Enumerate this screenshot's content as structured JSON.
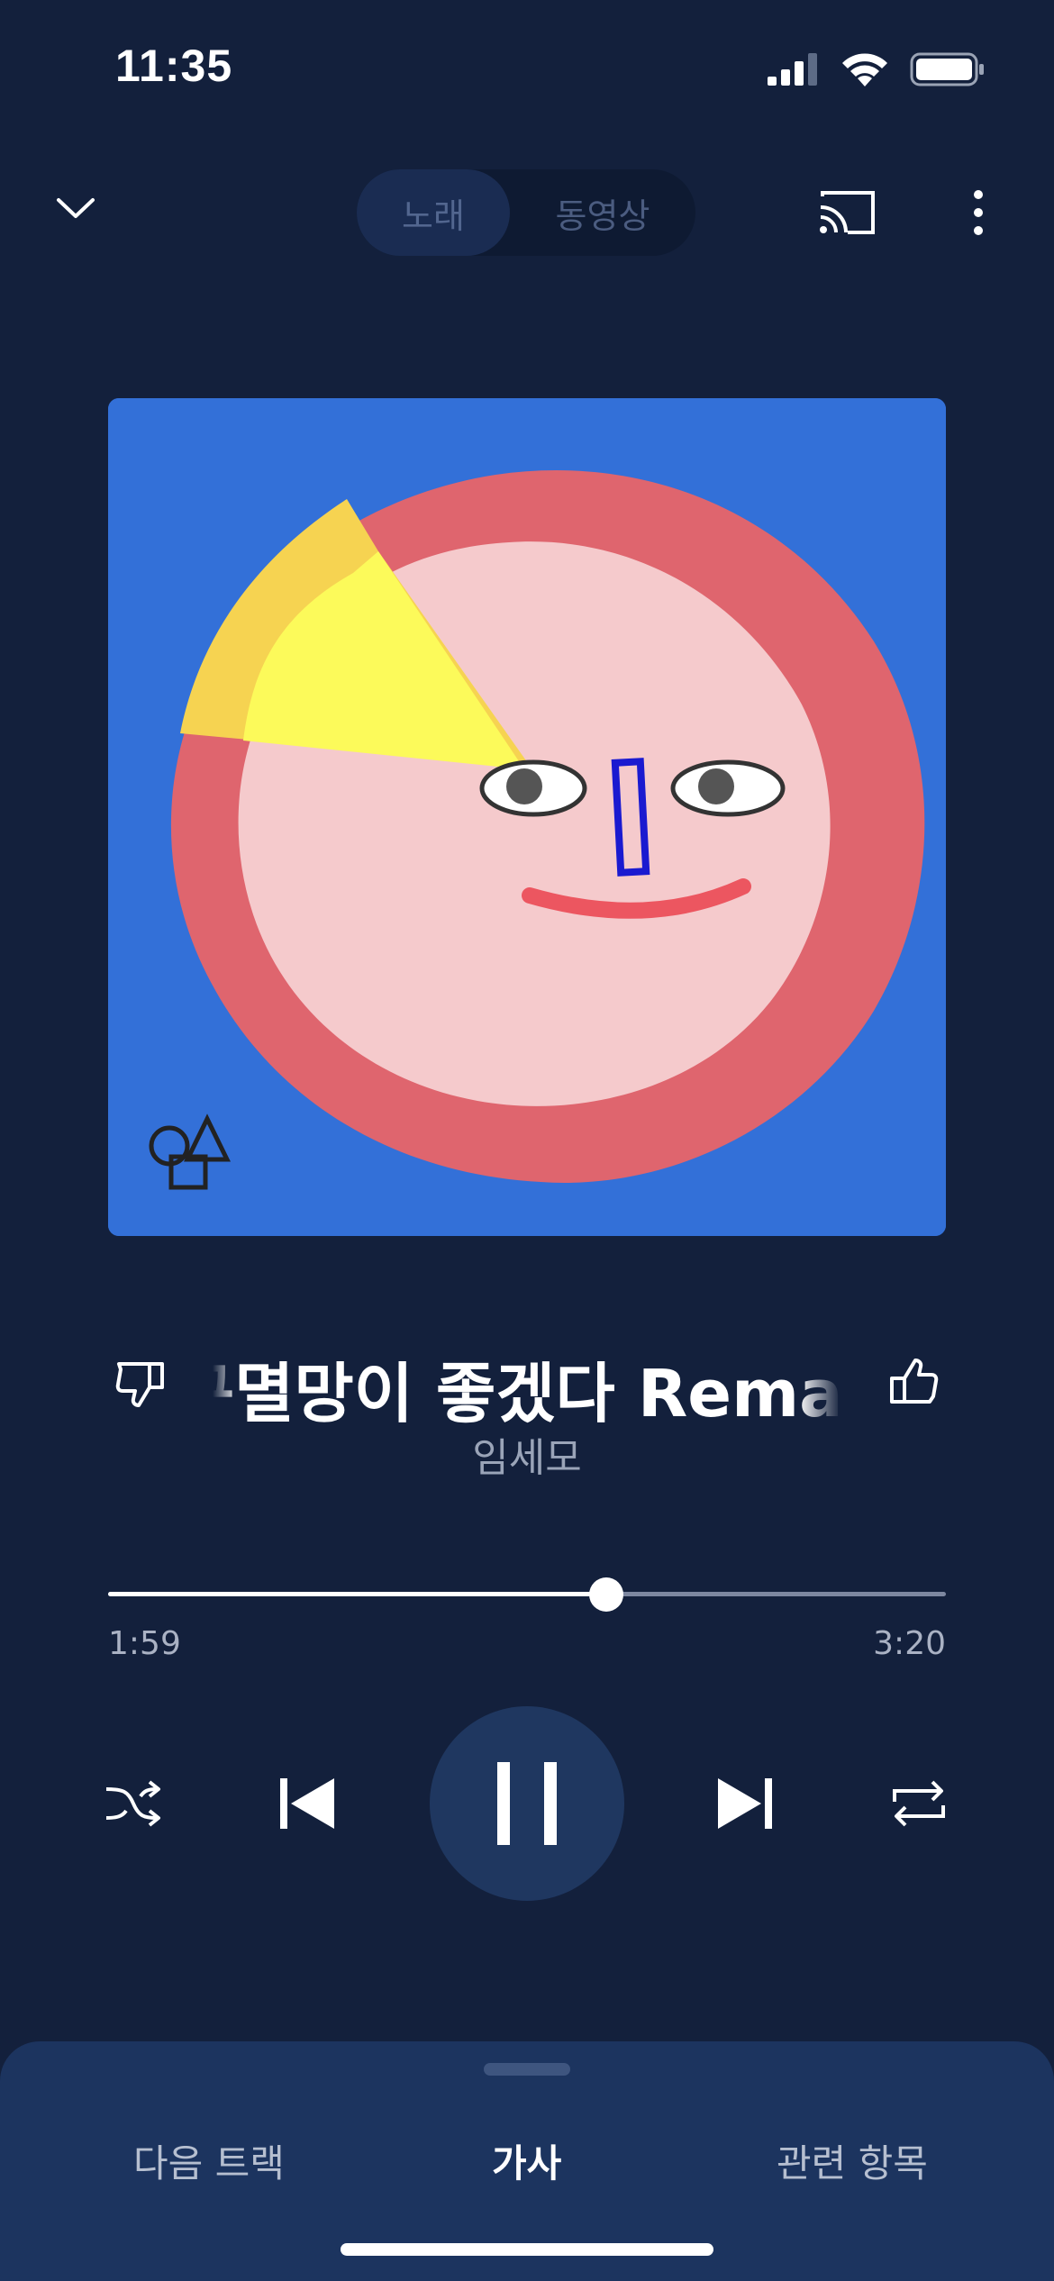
{
  "status_bar": {
    "time": "11:35",
    "icons": [
      "signal-icon",
      "wifi-icon",
      "battery-icon"
    ]
  },
  "top_bar": {
    "icons": [
      "chevron-down-icon",
      "cast-icon",
      "more-vert-icon"
    ],
    "tabs": [
      {
        "label": "노래",
        "active": true
      },
      {
        "label": "동영상",
        "active": false
      }
    ]
  },
  "track": {
    "title": "구멸망이 좋겠다 Remaster",
    "artist": "임세모"
  },
  "progress": {
    "elapsed": "1:59",
    "duration": "3:20",
    "fraction": 0.595
  },
  "controls": {
    "icons": [
      "shuffle-icon",
      "previous-icon",
      "pause-icon",
      "next-icon",
      "repeat-icon",
      "thumbs-down-icon",
      "thumbs-up-icon"
    ]
  },
  "bottom_tabs": [
    {
      "label": "다음 트랙",
      "active": false
    },
    {
      "label": "가사",
      "active": true
    },
    {
      "label": "관련 항목",
      "active": false
    }
  ],
  "colors": {
    "background": "#13203c",
    "sheet": "#1c345f",
    "play_button": "#1f3760",
    "album_bg": "#3370d8"
  }
}
